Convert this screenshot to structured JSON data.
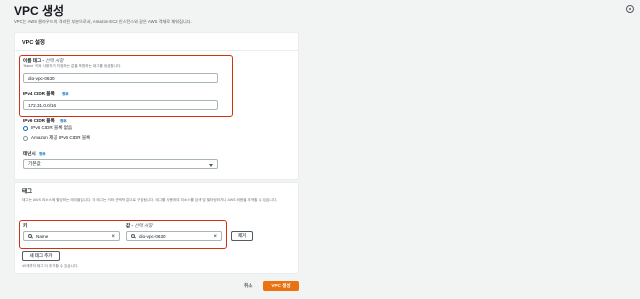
{
  "page": {
    "title": "VPC 생성",
    "description": "VPC는 AWS 클라우드의 격리된 부분으로서, Amazon EC2 인스턴스와 같은 AWS 객체로 채워집니다."
  },
  "vpc_settings": {
    "header": "VPC 설정",
    "name_tag": {
      "label": "이름 태그 - ",
      "optional": "선택 사항",
      "hint": "'Name' 키와 사용자가 지정하는 값을 포함하는 태그를 생성합니다.",
      "value": "dio-vpc-0630"
    },
    "ipv4": {
      "label": "IPv4 CIDR 블록",
      "info": "정보",
      "value": "172.31.0.0/16"
    },
    "ipv6": {
      "label": "IPv6 CIDR 블록",
      "info": "정보",
      "options": [
        "IPv6 CIDR 블록 없음",
        "Amazon 제공 IPv6 CIDR 블록"
      ],
      "selected_index": 0
    },
    "tenancy": {
      "label": "테넌시",
      "info": "정보",
      "value": "기본값"
    }
  },
  "tags": {
    "header": "태그",
    "description": "태그는 AWS 리소스에 할당하는 레이블입니다. 각 태그는 키와 선택적 값으로 구성됩니다. 태그를 사용하여 리소스를 검색 및 필터링하거나 AWS 비용을 추적할 수 있습니다.",
    "key_label": "키",
    "value_label": "값 - ",
    "value_optional": "선택 사항",
    "key_value": "Name",
    "value_value": "dio-vpc-0630",
    "remove_label": "제거",
    "add_label": "새 태그 추가",
    "limit_hint": "49개까지 태그 더 추가할 수 있습니다."
  },
  "footer": {
    "cancel_label": "취소",
    "create_label": "VPC 생성"
  },
  "colors": {
    "highlight": "#d13212",
    "primary": "#ec7211",
    "link": "#0073bb"
  }
}
